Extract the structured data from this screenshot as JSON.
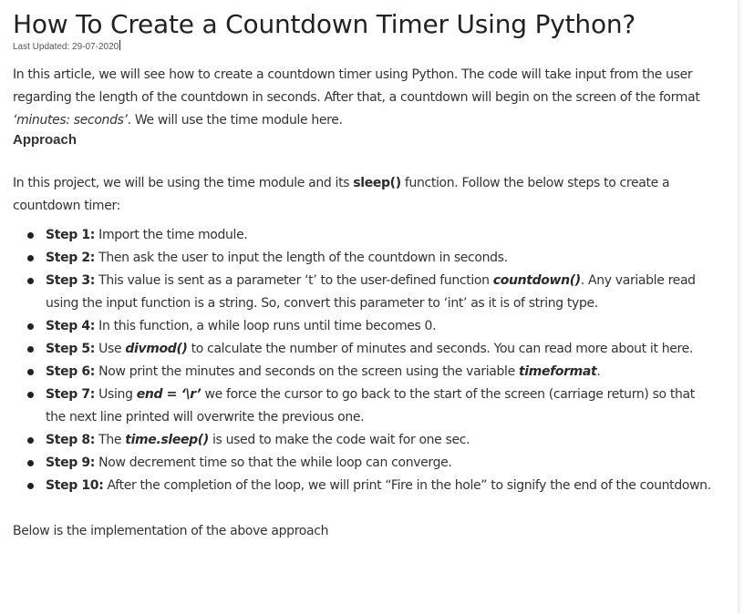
{
  "article": {
    "title": "How To Create a Countdown Timer Using Python?",
    "last_updated": "Last Updated: 29-07-2020",
    "intro_part1": "In this article, we will see how to create a countdown timer using Python. The code will take input from the user regarding the length of the countdown in seconds. After that, a countdown will begin on the screen of the format ",
    "intro_format": "‘minutes: seconds’",
    "intro_part2": ". We will use the time module here.",
    "approach_heading": "Approach",
    "project_part1": "In this project, we will be using the time module and its ",
    "project_sleep": "sleep()",
    "project_part2": " function. Follow the below steps to create a countdown timer:",
    "steps": [
      {
        "label": "Step 1:",
        "text": " Import the time module."
      },
      {
        "label": "Step 2:",
        "text": " Then ask the user to input the length of the countdown in seconds."
      },
      {
        "label": "Step 3:",
        "pre": " This value is sent as a parameter ‘t’ to the user-defined function ",
        "code": "countdown()",
        "post": ". Any variable read using the input function is a string. So, convert this parameter to ‘int’ as it is of string type."
      },
      {
        "label": "Step 4:",
        "text": " In this function, a while loop runs until time becomes 0."
      },
      {
        "label": "Step 5:",
        "pre": " Use ",
        "code": "divmod()",
        "post": " to calculate the number of minutes and seconds. You can read more about it here."
      },
      {
        "label": "Step 6:",
        "pre": " Now print the minutes and seconds on the screen using the variable ",
        "code": "timeformat",
        "post": "."
      },
      {
        "label": "Step 7:",
        "pre": " Using ",
        "code": "end = ‘\\r’",
        "post": " we force the cursor to go back to the start of the screen (carriage return) so that the next line printed will overwrite the previous one."
      },
      {
        "label": "Step 8:",
        "pre": " The ",
        "code": "time.sleep()",
        "post": " is used to make the code wait for one sec."
      },
      {
        "label": "Step 9:",
        "text": " Now decrement time so that the while loop can converge."
      },
      {
        "label": "Step 10:",
        "text": " After the completion of the loop, we will print “Fire in the hole” to signify the end of the countdown."
      }
    ],
    "below_text": "Below is the implementation of the above approach"
  }
}
